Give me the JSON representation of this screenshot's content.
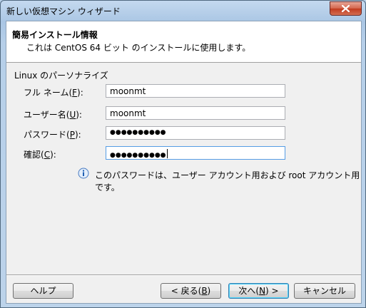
{
  "window": {
    "title": "新しい仮想マシン ウィザード"
  },
  "header": {
    "title": "簡易インストール情報",
    "subtitle": "これは CentOS 64 ビット のインストールに使用します。"
  },
  "form": {
    "group_label": "Linux のパーソナライズ",
    "fields": [
      {
        "label": "フル ネーム(",
        "key": "F",
        "label_end": "):",
        "value": "moonmt"
      },
      {
        "label": "ユーザー名(",
        "key": "U",
        "label_end": "):",
        "value": "moonmt"
      },
      {
        "label": "パスワード(",
        "key": "P",
        "label_end": "):",
        "value": "●●●●●●●●●●"
      },
      {
        "label": "確認(",
        "key": "C",
        "label_end": "):",
        "value": "●●●●●●●●●●"
      }
    ],
    "info_text": "このパスワードは、ユーザー アカウント用および root アカウント用です。"
  },
  "buttons": {
    "help": "ヘルプ",
    "back_pre": "< 戻る(",
    "back_key": "B",
    "back_post": ")",
    "next_pre": "次へ(",
    "next_key": "N",
    "next_post": ") >",
    "cancel": "キャンセル"
  }
}
